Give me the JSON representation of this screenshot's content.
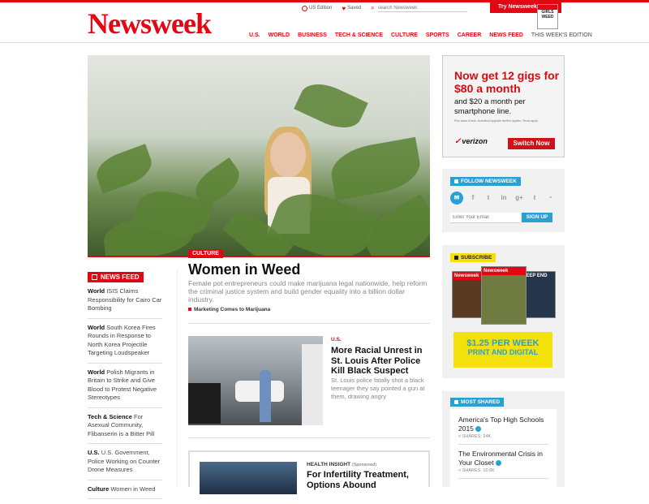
{
  "header": {
    "logo": "Newsweek",
    "edition": "US Edition",
    "saved": "Saved",
    "search_placeholder": "search Newsweek",
    "try_label": "Try Newsweek",
    "try_cover_text": "GIRLS WEED"
  },
  "nav": [
    "U.S.",
    "WORLD",
    "BUSINESS",
    "TECH & SCIENCE",
    "CULTURE",
    "SPORTS",
    "CAREER",
    "NEWS FEED",
    "THIS WEEK'S EDITION"
  ],
  "hero": {
    "tag": "CULTURE",
    "title": "Women in Weed",
    "description": "Female pot entrepreneurs could make marijuana legal nationwide, help reform the criminal justice system and build gender equality into a billion dollar industry.",
    "related": "Marketing Comes to Marijuana"
  },
  "news_feed": {
    "heading": "NEWS FEED",
    "items": [
      {
        "section": "World",
        "text": "ISIS Claims Responsibility for Cairo Car Bombing"
      },
      {
        "section": "World",
        "text": "South Korea Fires Rounds in Response to North Korea Projectile Targeting Loudspeaker"
      },
      {
        "section": "World",
        "text": "Polish Migrants in Britain to Strike and Give Blood to Protest Negative Stereotypes"
      },
      {
        "section": "Tech & Science",
        "text": "For Asexual Community, Flibanserin is a Bitter Pill"
      },
      {
        "section": "U.S.",
        "text": "U.S. Government, Police Working on Counter Drone Measures"
      },
      {
        "section": "Culture",
        "text": "Women in Weed"
      }
    ]
  },
  "story": {
    "section": "U.S.",
    "title": "More Racial Unrest in St. Louis After Police Kill Black Suspect",
    "description": "St. Louis police fatally shot a black teenager they say pointed a gun at them, drawing angry"
  },
  "promo": {
    "section": "HEALTH INSIGHT",
    "sponsored": "(Sponsored)",
    "title": "For Infertility Treatment, Options Abound"
  },
  "ad": {
    "headline": "Now get 12 gigs for $80 a month",
    "subline": "and $20 a month per smartphone line.",
    "fine_print": "Plus taxes & fees. Activation/upgrade fee/line applies. Terms apply.",
    "brand": "verizon",
    "button": "Switch Now"
  },
  "follow": {
    "heading": "FOLLOW NEWSWEEK",
    "icons": [
      "email-icon",
      "facebook-icon",
      "twitter-icon",
      "linkedin-icon",
      "googleplus-icon",
      "tumblr-icon",
      "rss-icon"
    ],
    "email_placeholder": "Enter Your Email",
    "signup": "SIGN UP"
  },
  "subscribe": {
    "heading": "SUBSCRIBE",
    "covers": [
      "Newsweek",
      "Newsweek",
      "DEEP END"
    ],
    "price_line1": "$1.25 PER WEEK",
    "price_line2": "PRINT AND DIGITAL"
  },
  "most_shared": {
    "heading": "MOST SHARED",
    "items": [
      {
        "title": "America's Top High Schools 2015",
        "shares": "SHARES: 24K"
      },
      {
        "title": "The Environmental Crisis in Your Closet",
        "shares": "SHARES: 10.6K"
      }
    ]
  },
  "colors": {
    "brand_red": "#e30613",
    "accent_blue": "#2aa1d6",
    "accent_yellow": "#f4e00a"
  }
}
